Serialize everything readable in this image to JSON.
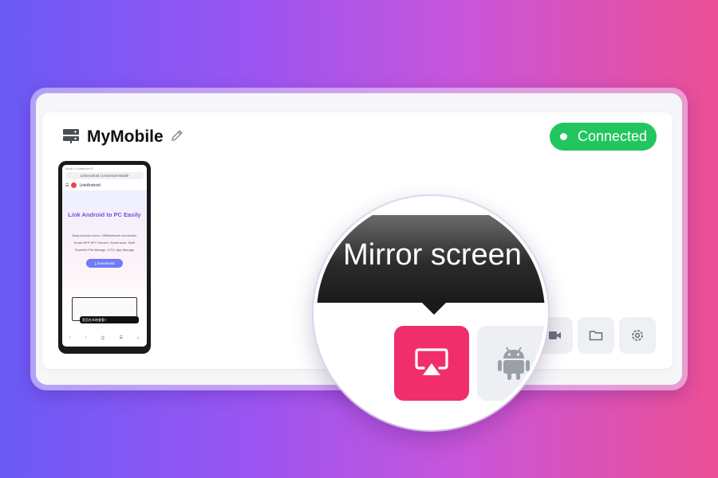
{
  "device": {
    "name": "MyMobile",
    "icon": "server-icon",
    "edit_icon": "pencil-icon"
  },
  "status": {
    "label": "Connected",
    "color": "#22c55e"
  },
  "phone_preview": {
    "status_bar": "Inkdir | Vodafone ID",
    "url": "LinkAndroid | Universal Mobile",
    "site_name": "LinkAndroid",
    "hero_title": "Link Android to PC Easily",
    "hero_lines": [
      "Easy Access mirror, USB/Network connection",
      "Smart NFP NFC Record, Screenshot, Shell",
      "Powerful File Manage, OTG, App Manage"
    ],
    "download_label": "⤓ Download",
    "toast_text": "是否在本地查看?",
    "nav": [
      "‹",
      "›",
      "⓶",
      "☰",
      "⌂"
    ]
  },
  "magnifier": {
    "tooltip_text": "Mirror screen",
    "accent_color": "#f02e6b"
  },
  "toolbar": {
    "buttons": [
      {
        "name": "record-video-button",
        "icon": "video-icon"
      },
      {
        "name": "file-manager-button",
        "icon": "folder-icon"
      },
      {
        "name": "settings-button",
        "icon": "gear-icon"
      }
    ],
    "mirror_button_icon": "screen-cast-icon",
    "android_button_icon": "android-icon"
  }
}
